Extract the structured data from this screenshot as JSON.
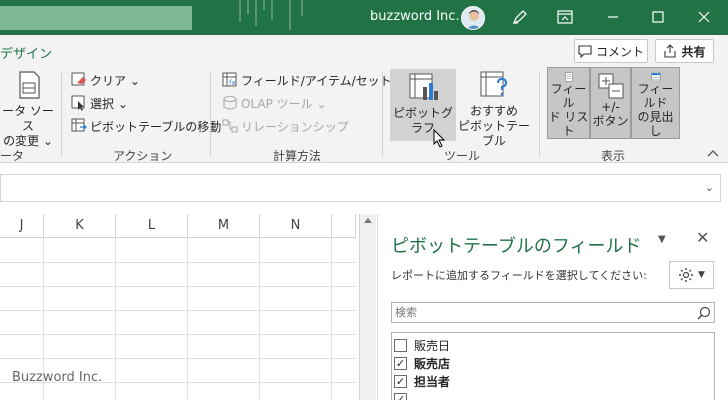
{
  "titlebar": {
    "account_name": "buzzword Inc.",
    "icons": [
      "avatar",
      "pen-icon",
      "ribbon-display-icon",
      "minimize-icon",
      "restore-icon",
      "close-icon"
    ]
  },
  "ribbon_tabs": {
    "design_tab": "デザイン",
    "comment_label": "コメント",
    "share_label": "共有"
  },
  "ribbon": {
    "data_group": {
      "change_source_line1": "ータ ソース",
      "change_source_line2": "の変更 ⌄",
      "label": "ータ"
    },
    "actions_group": {
      "clear": "クリア ⌄",
      "select": "選択 ⌄",
      "move": "ピボットテーブルの移動",
      "label": "アクション"
    },
    "calc_group": {
      "fields_items": "フィールド/アイテム/セット ⌄",
      "olap": "OLAP ツール ⌄",
      "relations": "リレーションシップ",
      "label": "計算方法"
    },
    "tools_group": {
      "pivot_chart": "ピボットグラフ",
      "recommended_line1": "おすすめ",
      "recommended_line2": "ピボットテーブル",
      "label": "ツール"
    },
    "show_group": {
      "field_list_line1": "フィール",
      "field_list_line2": "ド リスト",
      "buttons_line1": "+/-",
      "buttons_line2": "ボタン",
      "headers_line1": "フィールド",
      "headers_line2": "の見出し",
      "label": "表示"
    }
  },
  "grid": {
    "columns": [
      "J",
      "K",
      "L",
      "M",
      "N"
    ]
  },
  "watermark": "Buzzword Inc.",
  "pivot_pane": {
    "title": "ピボットテーブルのフィールド",
    "subtitle": "レポートに追加するフィールドを選択してください:",
    "search_placeholder": "検索",
    "fields": [
      {
        "label": "販売日",
        "checked": false
      },
      {
        "label": "販売店",
        "checked": true
      },
      {
        "label": "担当者",
        "checked": true
      }
    ]
  },
  "colors": {
    "title_bar": "#217346",
    "accent_green": "#217346",
    "ribbon_bg": "#f3f3f3",
    "toggled_button": "#c6c6c6"
  }
}
